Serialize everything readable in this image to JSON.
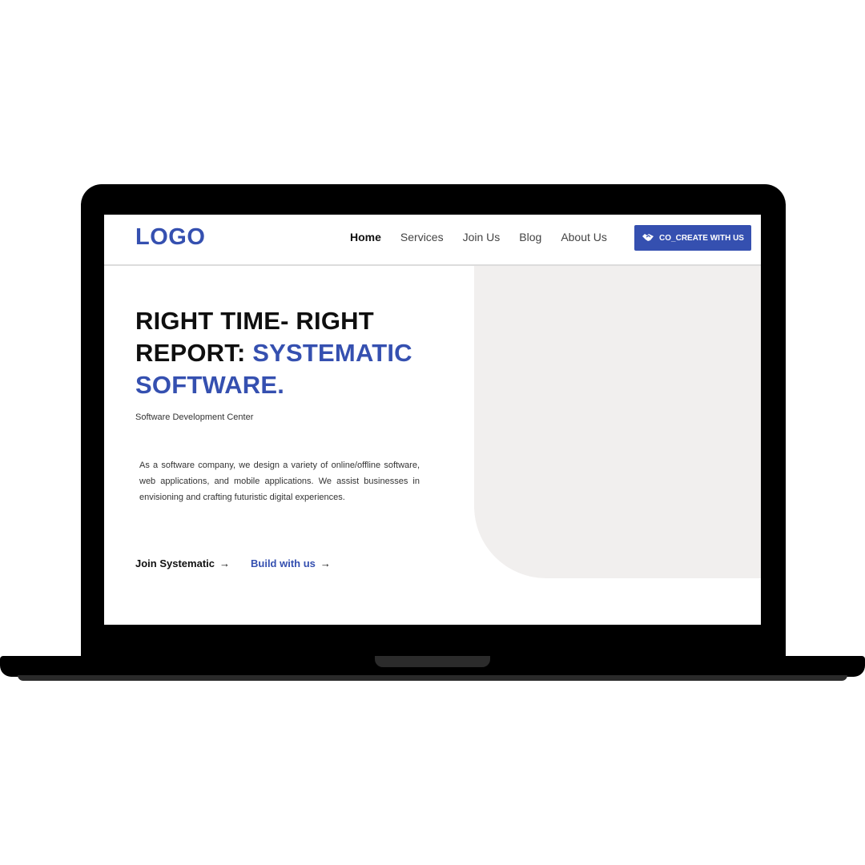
{
  "header": {
    "logo": "LOGO",
    "nav": [
      "Home",
      "Services",
      "Join Us",
      "Blog",
      "About Us"
    ],
    "cta": {
      "label": "CO_CREATE WITH US",
      "icon": "handshake-icon"
    }
  },
  "hero": {
    "title_line1": "RIGHT TIME- RIGHT",
    "title_line2_black": "REPORT: ",
    "title_line2_accent": "SYSTEMATIC",
    "title_line3_accent": "SOFTWARE.",
    "subtitle": "Software Development Center",
    "description": "As a software company, we design a variety of online/offline software, web applications, and mobile applications. We assist businesses in envisioning and crafting futuristic digital experiences.",
    "link_join": "Join Systematic",
    "link_build": "Build with us",
    "arrow": "→"
  },
  "colors": {
    "accent": "#3550b0",
    "panel": "#f1efee"
  }
}
